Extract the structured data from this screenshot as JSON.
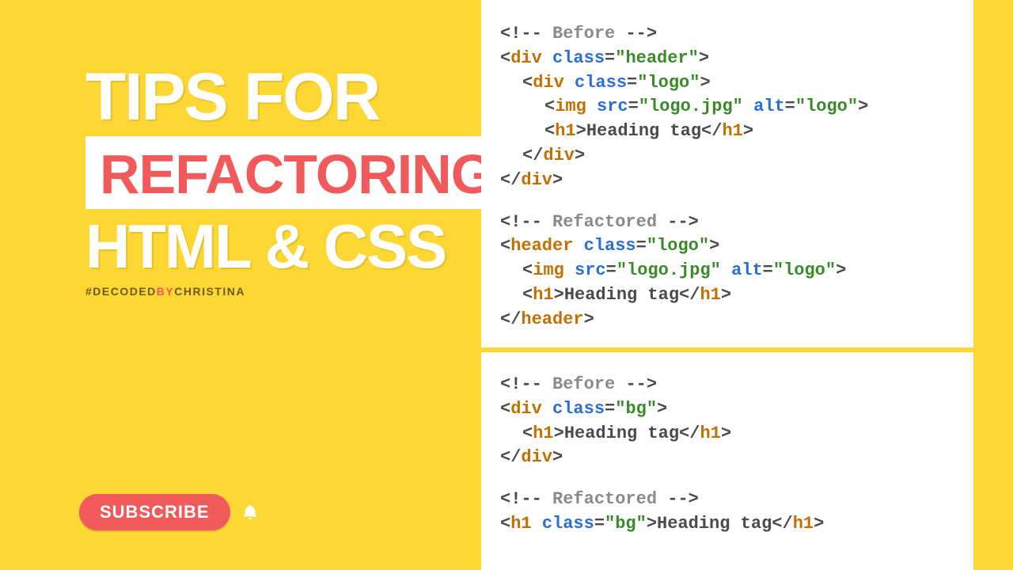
{
  "title": {
    "line1": "TIPS FOR",
    "line2": "REFACTORING",
    "line3": "HTML & CSS"
  },
  "hashtag": {
    "part1": "#DECODED",
    "part2": "BY",
    "part3": "CHRISTINA"
  },
  "subscribe": {
    "label": "SUBSCRIBE"
  },
  "code1": {
    "c1": "Before",
    "t1": "div",
    "a1": "class",
    "v1": "header",
    "t2": "div",
    "a2": "class",
    "v2": "logo",
    "t3": "img",
    "a3a": "src",
    "v3a": "logo.jpg",
    "a3b": "alt",
    "v3b": "logo",
    "t4": "h1",
    "txt4": "Heading tag",
    "c2": "Refactored",
    "t5": "header",
    "a5": "class",
    "v5": "logo",
    "t6": "img",
    "a6a": "src",
    "v6a": "logo.jpg",
    "a6b": "alt",
    "v6b": "logo",
    "t7": "h1",
    "txt7": "Heading tag"
  },
  "code2": {
    "c1": "Before",
    "t1": "div",
    "a1": "class",
    "v1": "bg",
    "t2": "h1",
    "txt2": "Heading tag",
    "c2": "Refactored",
    "t3": "h1",
    "a3": "class",
    "v3": "bg",
    "txt3": "Heading tag"
  }
}
